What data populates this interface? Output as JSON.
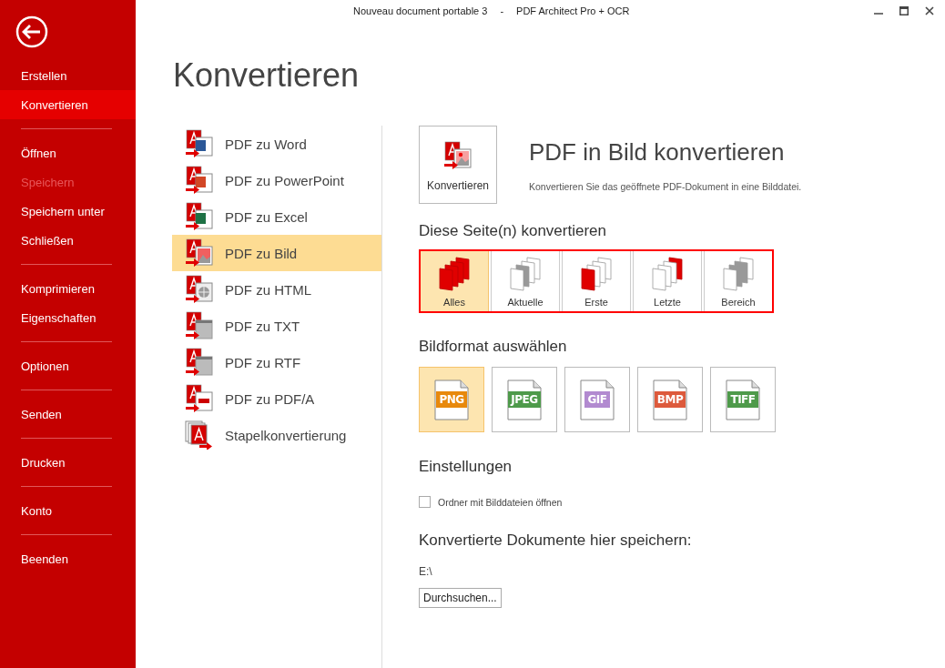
{
  "window": {
    "title_document": "Nouveau document portable 3",
    "title_separator": "-",
    "title_app": "PDF Architect Pro + OCR"
  },
  "sidebar": {
    "groups": [
      [
        {
          "label": "Erstellen",
          "selected": false,
          "disabled": false
        },
        {
          "label": "Konvertieren",
          "selected": true,
          "disabled": false
        }
      ],
      [
        {
          "label": "Öffnen",
          "selected": false,
          "disabled": false
        },
        {
          "label": "Speichern",
          "selected": false,
          "disabled": true
        },
        {
          "label": "Speichern unter",
          "selected": false,
          "disabled": false
        },
        {
          "label": "Schließen",
          "selected": false,
          "disabled": false
        }
      ],
      [
        {
          "label": "Komprimieren",
          "selected": false,
          "disabled": false
        },
        {
          "label": "Eigenschaften",
          "selected": false,
          "disabled": false
        }
      ],
      [
        {
          "label": "Optionen",
          "selected": false,
          "disabled": false
        }
      ],
      [
        {
          "label": "Senden",
          "selected": false,
          "disabled": false
        }
      ],
      [
        {
          "label": "Drucken",
          "selected": false,
          "disabled": false
        }
      ],
      [
        {
          "label": "Konto",
          "selected": false,
          "disabled": false
        }
      ],
      [
        {
          "label": "Beenden",
          "selected": false,
          "disabled": false
        }
      ]
    ]
  },
  "page_title": "Konvertieren",
  "conversions": [
    {
      "label": "PDF zu Word",
      "kind": "word",
      "selected": false
    },
    {
      "label": "PDF zu PowerPoint",
      "kind": "powerpoint",
      "selected": false
    },
    {
      "label": "PDF zu Excel",
      "kind": "excel",
      "selected": false
    },
    {
      "label": "PDF zu Bild",
      "kind": "image",
      "selected": true
    },
    {
      "label": "PDF zu HTML",
      "kind": "html",
      "selected": false
    },
    {
      "label": "PDF zu TXT",
      "kind": "txt",
      "selected": false
    },
    {
      "label": "PDF zu RTF",
      "kind": "rtf",
      "selected": false
    },
    {
      "label": "PDF zu PDF/A",
      "kind": "pdfa",
      "selected": false
    },
    {
      "label": "Stapelkonvertierung",
      "kind": "batch",
      "selected": false
    }
  ],
  "detail": {
    "convert_button": "Konvertieren",
    "heading": "PDF in Bild konvertieren",
    "description": "Konvertieren Sie das geöffnete PDF-Dokument in eine Bilddatei.",
    "pages_heading": "Diese Seite(n) konvertieren",
    "page_options": [
      {
        "label": "Alles",
        "kind": "all",
        "selected": true
      },
      {
        "label": "Aktuelle",
        "kind": "current",
        "selected": false
      },
      {
        "label": "Erste",
        "kind": "first",
        "selected": false
      },
      {
        "label": "Letzte",
        "kind": "last",
        "selected": false
      },
      {
        "label": "Bereich",
        "kind": "range",
        "selected": false
      }
    ],
    "format_heading": "Bildformat auswählen",
    "formats": [
      {
        "label": "PNG",
        "color": "#e8890c",
        "selected": true
      },
      {
        "label": "JPEG",
        "color": "#4e9a4a",
        "selected": false
      },
      {
        "label": "GIF",
        "color": "#b28ad0",
        "selected": false
      },
      {
        "label": "BMP",
        "color": "#dd5a3c",
        "selected": false
      },
      {
        "label": "TIFF",
        "color": "#4e9a4a",
        "selected": false
      }
    ],
    "settings_heading": "Einstellungen",
    "settings": [
      {
        "label": "Ordner mit Bilddateien öffnen",
        "checked": false
      }
    ],
    "save_heading": "Konvertierte Dokumente hier speichern:",
    "save_path": "E:\\",
    "browse_button": "Durchsuchen..."
  }
}
